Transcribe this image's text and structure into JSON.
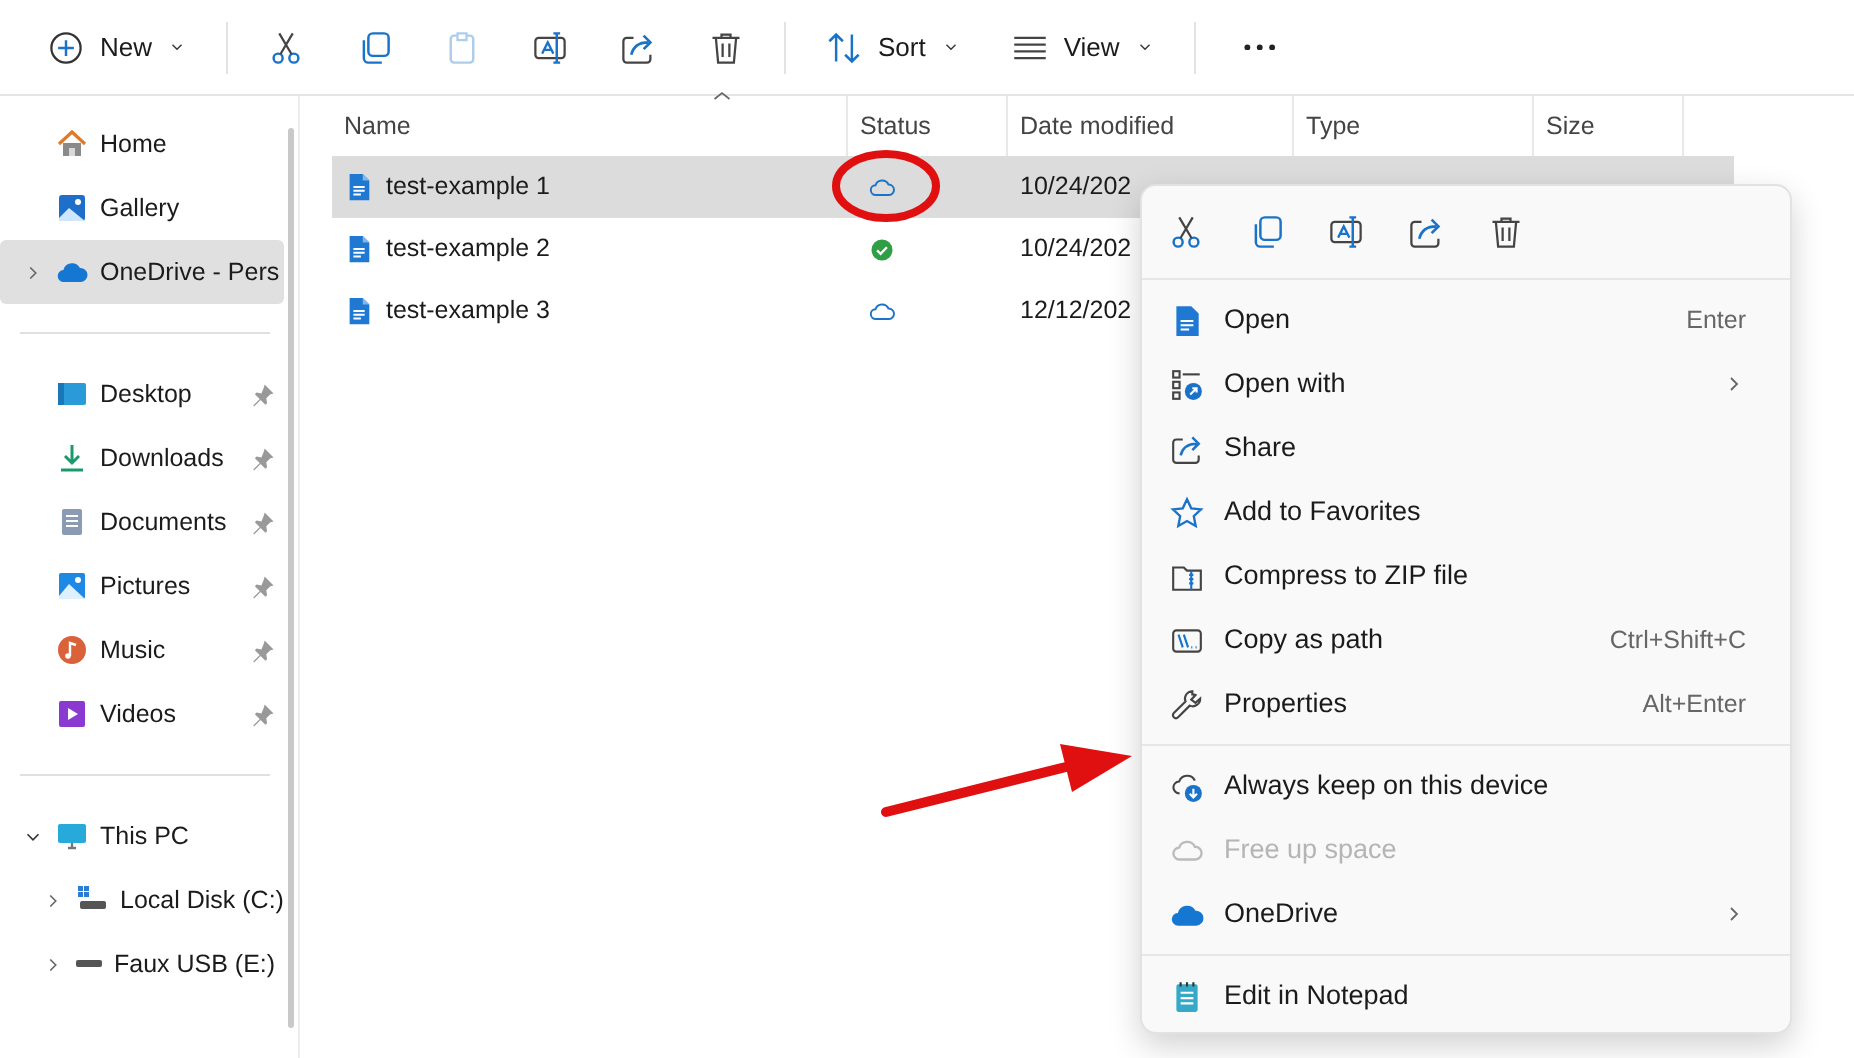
{
  "toolbar": {
    "items": [
      {
        "kind": "new",
        "label": "New",
        "dropdown": true,
        "disabled": false
      },
      {
        "kind": "cut",
        "disabled": false
      },
      {
        "kind": "copy",
        "disabled": false
      },
      {
        "kind": "paste",
        "disabled": true
      },
      {
        "kind": "rename",
        "disabled": false
      },
      {
        "kind": "share",
        "disabled": false
      },
      {
        "kind": "delete",
        "disabled": false
      },
      {
        "kind": "sort",
        "label": "Sort",
        "dropdown": true,
        "disabled": false
      },
      {
        "kind": "view",
        "label": "View",
        "dropdown": true,
        "disabled": false
      },
      {
        "kind": "more",
        "disabled": false
      }
    ]
  },
  "sidebar": {
    "sections": [
      {
        "items": [
          {
            "kind": "home",
            "label": "Home",
            "selected": false
          },
          {
            "kind": "gallery",
            "label": "Gallery",
            "selected": false
          },
          {
            "kind": "onedrive",
            "label": "OneDrive - Pers",
            "selected": true,
            "expanded": false
          }
        ]
      },
      {
        "items": [
          {
            "kind": "desktop",
            "label": "Desktop",
            "pinned": true,
            "selected": false
          },
          {
            "kind": "downloads",
            "label": "Downloads",
            "pinned": true,
            "selected": false
          },
          {
            "kind": "documents",
            "label": "Documents",
            "pinned": true,
            "selected": false
          },
          {
            "kind": "pictures",
            "label": "Pictures",
            "pinned": true,
            "selected": false
          },
          {
            "kind": "music",
            "label": "Music",
            "pinned": true,
            "selected": false
          },
          {
            "kind": "videos",
            "label": "Videos",
            "pinned": true,
            "selected": false
          }
        ]
      },
      {
        "items": [
          {
            "kind": "pc",
            "label": "This PC",
            "selected": false,
            "expanded": true,
            "children": [
              {
                "kind": "disk",
                "label": "Local Disk (C:)",
                "selected": false,
                "expanded": false
              },
              {
                "kind": "usb",
                "label": "Faux USB (E:)",
                "selected": false,
                "expanded": false
              }
            ]
          }
        ]
      }
    ]
  },
  "table": {
    "columns": [
      {
        "label": "Name",
        "sorted": true
      },
      {
        "label": "Status"
      },
      {
        "label": "Date modified"
      },
      {
        "label": "Type"
      },
      {
        "label": "Size"
      }
    ],
    "rows": [
      {
        "name": "test-example 1",
        "status": {
          "kind": "cloud"
        },
        "date": "10/24/202",
        "selected": true
      },
      {
        "name": "test-example 2",
        "status": {
          "kind": "synced"
        },
        "date": "10/24/202",
        "selected": false
      },
      {
        "name": "test-example 3",
        "status": {
          "kind": "cloud"
        },
        "date": "12/12/202",
        "selected": false
      }
    ]
  },
  "context_menu": {
    "quick_actions": [
      {
        "kind": "cut"
      },
      {
        "kind": "copy"
      },
      {
        "kind": "rename"
      },
      {
        "kind": "share"
      },
      {
        "kind": "delete"
      }
    ],
    "groups": [
      [
        {
          "kind": "open",
          "label": "Open",
          "shortcut": "Enter",
          "disabled": false
        },
        {
          "kind": "open_with",
          "label": "Open with",
          "submenu": true,
          "disabled": false
        },
        {
          "kind": "share",
          "label": "Share",
          "disabled": false
        },
        {
          "kind": "favorite",
          "label": "Add to Favorites",
          "disabled": false
        },
        {
          "kind": "zip",
          "label": "Compress to ZIP file",
          "disabled": false
        },
        {
          "kind": "path",
          "label": "Copy as path",
          "shortcut": "Ctrl+Shift+C",
          "disabled": false
        },
        {
          "kind": "properties",
          "label": "Properties",
          "shortcut": "Alt+Enter",
          "disabled": false
        }
      ],
      [
        {
          "kind": "keep",
          "label": "Always keep on this device",
          "disabled": false
        },
        {
          "kind": "free",
          "label": "Free up space",
          "disabled": true
        },
        {
          "kind": "onedrive",
          "label": "OneDrive",
          "submenu": true,
          "disabled": false
        }
      ],
      [
        {
          "kind": "notepad",
          "label": "Edit in Notepad",
          "disabled": false
        }
      ]
    ]
  }
}
